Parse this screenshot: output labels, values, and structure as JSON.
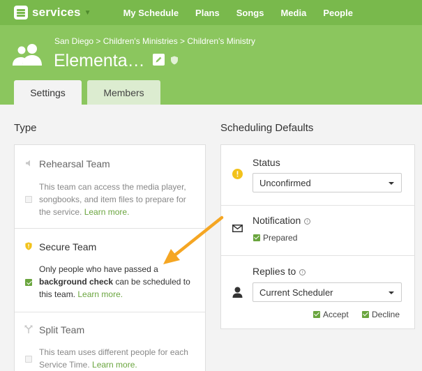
{
  "nav": {
    "brand": "services",
    "links": [
      "My Schedule",
      "Plans",
      "Songs",
      "Media",
      "People"
    ]
  },
  "header": {
    "breadcrumb": "San Diego > Children's Ministries > Children's Ministry",
    "title": "Elementa…",
    "tabs": {
      "settings": "Settings",
      "members": "Members"
    }
  },
  "type": {
    "heading": "Type",
    "options": [
      {
        "title": "Rehearsal Team",
        "desc": "This team can access the media player, songbooks, and item files to prepare for the service.",
        "link": "Learn more.",
        "checked": false
      },
      {
        "title": "Secure Team",
        "desc_before": "Only people who have passed a",
        "desc_bold": "background check",
        "desc_after": "can be scheduled to this team.",
        "link": "Learn more.",
        "checked": true
      },
      {
        "title": "Split Team",
        "desc": "This team uses different people for each Service Time.",
        "link": "Learn more.",
        "checked": false
      }
    ]
  },
  "scheduling": {
    "heading": "Scheduling Defaults",
    "status": {
      "label": "Status",
      "value": "Unconfirmed"
    },
    "notification": {
      "label": "Notification",
      "option": "Prepared"
    },
    "replies": {
      "label": "Replies to",
      "value": "Current Scheduler",
      "accept": "Accept",
      "decline": "Decline"
    }
  },
  "colors": {
    "nav_green": "#79b94c",
    "header_green": "#8bc65e",
    "accent": "#6aa53e",
    "warning_yellow": "#f2c21b",
    "annotation_arrow": "#f5a623"
  }
}
